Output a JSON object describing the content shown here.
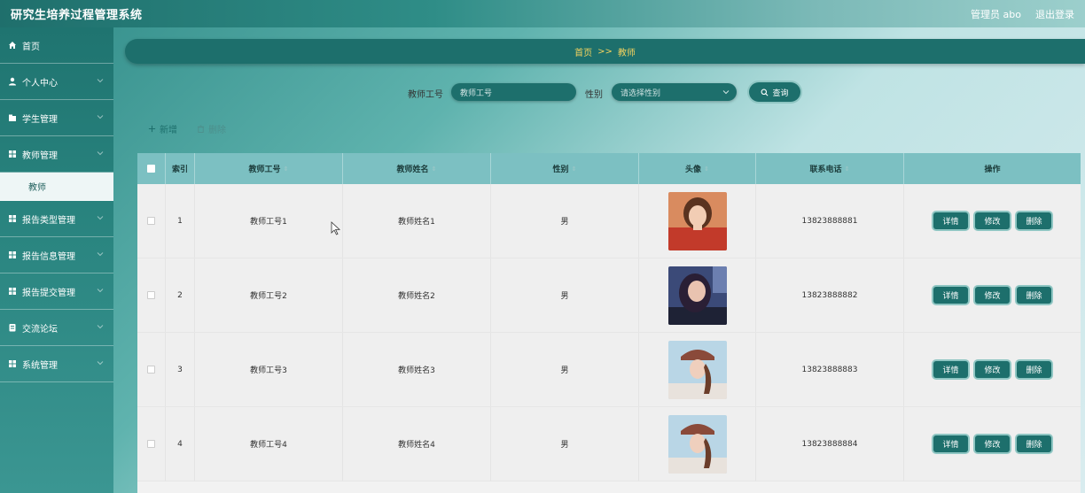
{
  "header": {
    "app_title": "研究生培养过程管理系统",
    "user_label": "管理员 abo",
    "logout_label": "退出登录"
  },
  "sidebar": {
    "items": [
      {
        "label": "首页",
        "icon": "home-icon"
      },
      {
        "label": "个人中心",
        "icon": "user-icon"
      },
      {
        "label": "学生管理",
        "icon": "grid-icon"
      },
      {
        "label": "教师管理",
        "icon": "grid-icon"
      },
      {
        "label": "报告类型管理",
        "icon": "grid-icon"
      },
      {
        "label": "报告信息管理",
        "icon": "grid-icon"
      },
      {
        "label": "报告提交管理",
        "icon": "grid-icon"
      },
      {
        "label": "交流论坛",
        "icon": "forum-icon"
      },
      {
        "label": "系统管理",
        "icon": "grid-icon"
      }
    ],
    "sub_teacher": "教师"
  },
  "breadcrumb": {
    "home": "首页",
    "sep": ">>",
    "current": "教师"
  },
  "search": {
    "id_label": "教师工号",
    "id_placeholder": "教师工号",
    "gender_label": "性别",
    "gender_placeholder": "请选择性别",
    "search_button": "查询"
  },
  "actions": {
    "add": "新增",
    "delete": "删除"
  },
  "table": {
    "headers": [
      "索引",
      "教师工号",
      "教师姓名",
      "性别",
      "头像",
      "联系电话",
      "操作"
    ],
    "rows": [
      {
        "index": "1",
        "id": "教师工号1",
        "name": "教师姓名1",
        "gender": "男",
        "phone": "13823888881"
      },
      {
        "index": "2",
        "id": "教师工号2",
        "name": "教师姓名2",
        "gender": "男",
        "phone": "13823888882"
      },
      {
        "index": "3",
        "id": "教师工号3",
        "name": "教师姓名3",
        "gender": "男",
        "phone": "13823888883"
      },
      {
        "index": "4",
        "id": "教师工号4",
        "name": "教师姓名4",
        "gender": "男",
        "phone": "13823888884"
      }
    ],
    "row_buttons": {
      "detail": "详情",
      "edit": "修改",
      "delete": "删除"
    }
  },
  "colors": {
    "primary": "#1d6f6c",
    "header_bg": "#7cc0c2",
    "breadcrumb_text": "#f4d35e"
  }
}
